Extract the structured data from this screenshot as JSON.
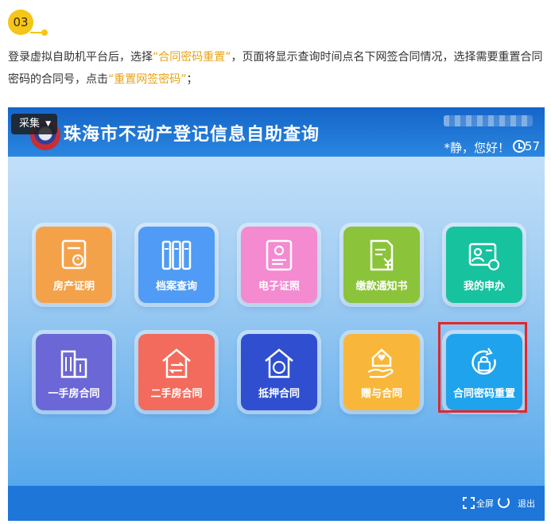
{
  "step": {
    "number": "03"
  },
  "intro": {
    "p1": "登录虚拟自助机平台后，选择",
    "h1": "“合同密码重置”",
    "p2": "，页面将显示查询时间点名下网签合同情况，选择需要重置合同密码的合同号，点击",
    "h2": "“重置网签密码”",
    "p3": "；"
  },
  "app": {
    "title": "珠海市不动产登记信息自助查询",
    "collect_label": "采集",
    "greeting": "*静，您好！",
    "countdown": "57"
  },
  "tiles": [
    {
      "label": "房产证明",
      "icon": "property-certificate-icon",
      "color": "#f4a24a"
    },
    {
      "label": "档案查询",
      "icon": "archive-binders-icon",
      "color": "#4f9bf5"
    },
    {
      "label": "电子证照",
      "icon": "e-license-icon",
      "color": "#f48ad0"
    },
    {
      "label": "缴款通知书",
      "icon": "payment-notice-icon",
      "color": "#8bc33a"
    },
    {
      "label": "我的申办",
      "icon": "my-applications-icon",
      "color": "#17c29f"
    },
    {
      "label": "一手房合同",
      "icon": "building-icon",
      "color": "#6b67d6"
    },
    {
      "label": "二手房合同",
      "icon": "house-exchange-icon",
      "color": "#f26b5c"
    },
    {
      "label": "抵押合同",
      "icon": "mortgage-house-icon",
      "color": "#2f4fd0"
    },
    {
      "label": "赠与合同",
      "icon": "gift-house-icon",
      "color": "#f8b73a"
    },
    {
      "label": "合同密码重置",
      "icon": "password-reset-lock-icon",
      "color": "#1fa3ec"
    }
  ],
  "footer": {
    "fullscreen": "全屏",
    "exit": "退出"
  },
  "colors": {
    "accent": "#e8a317",
    "highlight": "#e4262b",
    "topbar": "#1565c8"
  }
}
